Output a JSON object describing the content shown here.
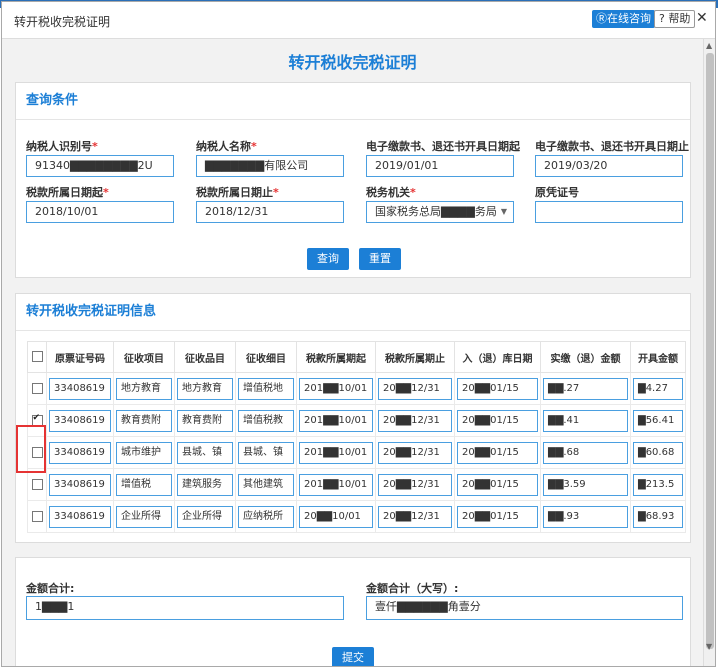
{
  "dialog": {
    "title": "转开税收完税证明",
    "consult_label": "在线咨询",
    "help_label": "? 帮助",
    "close": "✕"
  },
  "page_title": "转开税收完税证明",
  "query": {
    "section_title": "查询条件",
    "taxpayer_id": {
      "label": "纳税人识别号",
      "value": "91340▇▇▇▇▇▇▇▇2U"
    },
    "taxpayer_name": {
      "label": "纳税人名称",
      "value": "▇▇▇▇▇▇▇有限公司"
    },
    "date_start": {
      "label": "电子缴款书、退还书开具日期起",
      "value": "2019/01/01"
    },
    "date_end": {
      "label": "电子缴款书、退还书开具日期止",
      "value": "2019/03/20"
    },
    "period_start": {
      "label": "税款所属日期起",
      "value": "2018/10/01"
    },
    "period_end": {
      "label": "税款所属日期止",
      "value": "2018/12/31"
    },
    "tax_office": {
      "label": "税务机关",
      "value": "国家税务总局▇▇▇▇务局"
    },
    "original_cert": {
      "label": "原凭证号",
      "value": ""
    },
    "query_button": "查询",
    "reset_button": "重置"
  },
  "results": {
    "section_title": "转开税收完税证明信息",
    "columns": [
      "原票证号码",
      "征收项目",
      "征收品目",
      "征收细目",
      "税款所属期起",
      "税款所属期止",
      "入（退）库日期",
      "实缴（退）金额",
      "开具金额"
    ],
    "rows": [
      {
        "checked": false,
        "cells": [
          "33408619",
          "地方教育",
          "地方教育",
          "增值税地",
          "201▇▇10/01",
          "20▇▇12/31",
          "20▇▇01/15",
          "▇▇.27",
          "▇4.27"
        ]
      },
      {
        "checked": true,
        "cells": [
          "33408619",
          "教育费附",
          "教育费附",
          "增值税教",
          "201▇▇10/01",
          "20▇▇12/31",
          "20▇▇01/15",
          "▇▇.41",
          "▇56.41"
        ]
      },
      {
        "checked": false,
        "cells": [
          "33408619",
          "城市维护",
          "县城、镇",
          "县城、镇",
          "201▇▇10/01",
          "20▇▇12/31",
          "20▇▇01/15",
          "▇▇.68",
          "▇60.68"
        ]
      },
      {
        "checked": false,
        "cells": [
          "33408619",
          "增值税",
          "建筑服务",
          "其他建筑",
          "201▇▇10/01",
          "20▇▇12/31",
          "20▇▇01/15",
          "▇▇3.59",
          "▇213.5"
        ]
      },
      {
        "checked": false,
        "cells": [
          "33408619",
          "企业所得",
          "企业所得",
          "应纳税所",
          "20▇▇10/01",
          "20▇▇12/31",
          "20▇▇01/15",
          "▇▇.93",
          "▇68.93"
        ]
      }
    ]
  },
  "totals": {
    "amount_label": "金额合计:",
    "amount_value": "1▇▇▇1",
    "amount_caps_label": "金额合计（大写）:",
    "amount_caps_value": "壹仟▇▇▇▇▇▇角壹分",
    "submit_button": "提交"
  }
}
